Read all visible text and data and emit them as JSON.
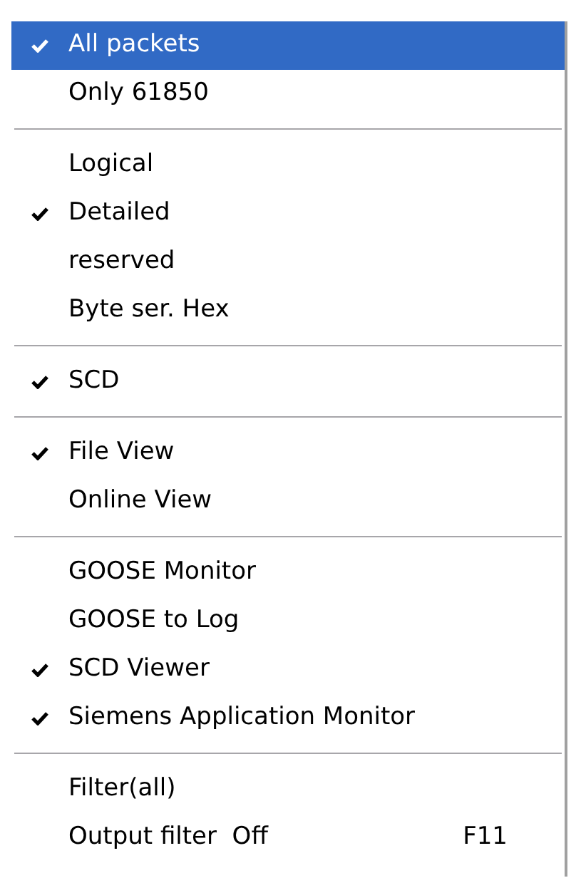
{
  "menu": {
    "groups": [
      {
        "items": [
          {
            "label": "All packets",
            "checked": true,
            "selected": true
          },
          {
            "label": "Only 61850",
            "checked": false,
            "selected": false
          }
        ]
      },
      {
        "items": [
          {
            "label": "Logical",
            "checked": false,
            "selected": false
          },
          {
            "label": "Detailed",
            "checked": true,
            "selected": false
          },
          {
            "label": "reserved",
            "checked": false,
            "selected": false
          },
          {
            "label": "Byte ser. Hex",
            "checked": false,
            "selected": false
          }
        ]
      },
      {
        "items": [
          {
            "label": "SCD",
            "checked": true,
            "selected": false
          }
        ]
      },
      {
        "items": [
          {
            "label": "File View",
            "checked": true,
            "selected": false
          },
          {
            "label": "Online View",
            "checked": false,
            "selected": false
          }
        ]
      },
      {
        "items": [
          {
            "label": "GOOSE Monitor",
            "checked": false,
            "selected": false
          },
          {
            "label": "GOOSE to Log",
            "checked": false,
            "selected": false
          },
          {
            "label": "SCD Viewer",
            "checked": true,
            "selected": false
          },
          {
            "label": "Siemens Application Monitor",
            "checked": true,
            "selected": false
          }
        ]
      },
      {
        "items": [
          {
            "label": "Filter(all)",
            "checked": false,
            "selected": false
          },
          {
            "label": "Output filter  Off",
            "shortcut": "F11",
            "checked": false,
            "selected": false
          }
        ]
      }
    ]
  }
}
